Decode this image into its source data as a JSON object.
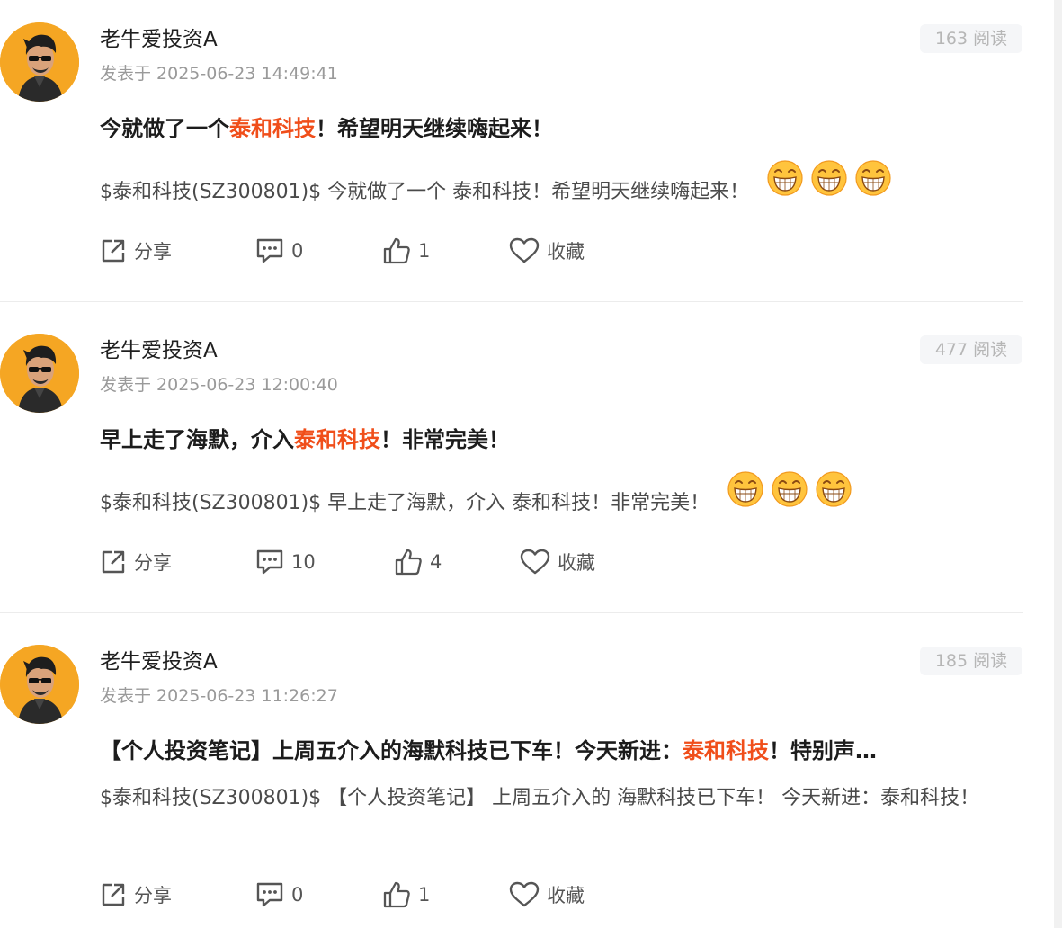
{
  "colors": {
    "highlight": "#f04e1a",
    "avatar_bg": "#f5a623",
    "reads_bg": "#f5f6f8"
  },
  "actions_labels": {
    "share": "分享",
    "favorite": "收藏"
  },
  "posts": [
    {
      "author": "老牛爱投资A",
      "meta_prefix": "发表于",
      "timestamp": "2025-06-23 14:49:41",
      "reads": "163 阅读",
      "title_before": "今就做了一个",
      "title_highlight": "泰和科技",
      "title_after": "！希望明天继续嗨起来！",
      "body": "$泰和科技(SZ300801)$ 今就做了一个 泰和科技！希望明天继续嗨起来！",
      "emoji_icon": "grin-face-icon",
      "comments": "0",
      "likes": "1"
    },
    {
      "author": "老牛爱投资A",
      "meta_prefix": "发表于",
      "timestamp": "2025-06-23 12:00:40",
      "reads": "477 阅读",
      "title_before": "早上走了海默，介入",
      "title_highlight": "泰和科技",
      "title_after": "！非常完美！",
      "body": "$泰和科技(SZ300801)$ 早上走了海默，介入 泰和科技！非常完美！",
      "emoji_icon": "grin-face-icon",
      "comments": "10",
      "likes": "4"
    },
    {
      "author": "老牛爱投资A",
      "meta_prefix": "发表于",
      "timestamp": "2025-06-23 11:26:27",
      "reads": "185 阅读",
      "title_before": "【个人投资笔记】上周五介入的海默科技已下车！今天新进：",
      "title_highlight": "泰和科技",
      "title_after": "！特别声…",
      "body": "$泰和科技(SZ300801)$ 【个人投资笔记】 上周五介入的 海默科技已下车！ 今天新进：泰和科技！",
      "comments": "0",
      "likes": "1"
    }
  ]
}
